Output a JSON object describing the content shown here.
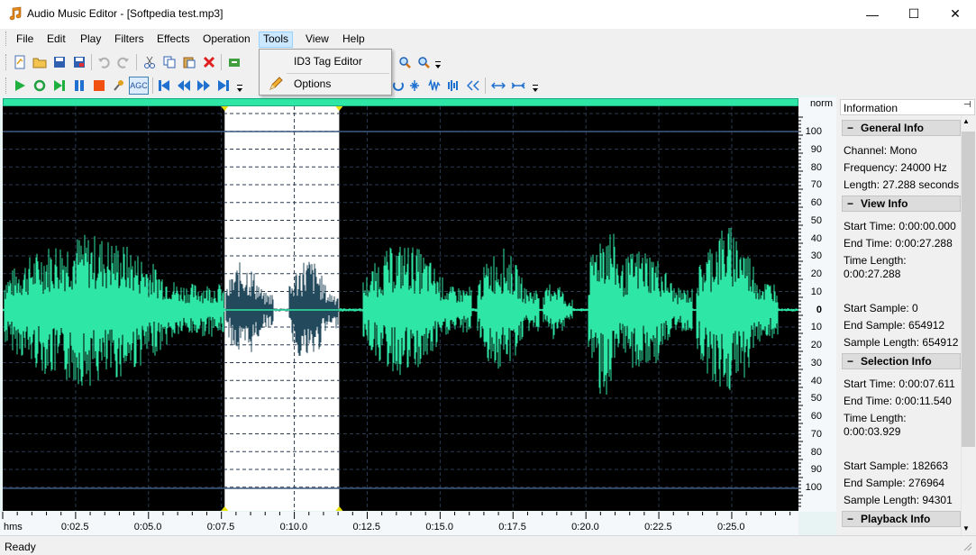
{
  "window": {
    "title": "Audio Music Editor - [Softpedia test.mp3]",
    "minimize": "—",
    "maximize": "☐",
    "close": "✕"
  },
  "menu": [
    {
      "label": "File"
    },
    {
      "label": "Edit"
    },
    {
      "label": "Play"
    },
    {
      "label": "Filters"
    },
    {
      "label": "Effects"
    },
    {
      "label": "Operation"
    },
    {
      "label": "Tools"
    },
    {
      "label": "View"
    },
    {
      "label": "Help"
    }
  ],
  "tools_dropdown": [
    {
      "label": "ID3 Tag Editor"
    },
    {
      "label": "Options"
    }
  ],
  "toolbar_agc": "AGC",
  "ruler": {
    "header": "norm",
    "labels": [
      "100",
      "90",
      "80",
      "70",
      "60",
      "50",
      "40",
      "30",
      "20",
      "10",
      "0",
      "10",
      "20",
      "30",
      "40",
      "50",
      "60",
      "70",
      "80",
      "90",
      "100"
    ]
  },
  "timeline": {
    "unit": "hms",
    "labels": [
      "0:02.5",
      "0:05.0",
      "0:07.5",
      "0:10.0",
      "0:12.5",
      "0:15.0",
      "0:17.5",
      "0:20.0",
      "0:22.5",
      "0:25.0"
    ]
  },
  "status": "Ready",
  "info": {
    "title": "Information",
    "pin": "📌",
    "general": {
      "heading": "General Info",
      "channel": "Channel: Mono",
      "frequency": "Frequency: 24000 Hz",
      "length": "Length: 27.288 seconds"
    },
    "view": {
      "heading": "View Info",
      "start_time": "Start Time: 0:00:00.000",
      "end_time": "End Time: 0:00:27.288",
      "time_length_label": "Time Length:",
      "time_length": "0:00:27.288",
      "start_sample": "Start Sample: 0",
      "end_sample": "End Sample: 654912",
      "sample_length": "Sample Length: 654912"
    },
    "selection": {
      "heading": "Selection Info",
      "start_time": "Start Time: 0:00:07.611",
      "end_time": "End Time: 0:00:11.540",
      "time_length_label": "Time Length:",
      "time_length": "0:00:03.929",
      "start_sample": "Start Sample: 182663",
      "end_sample": "End Sample: 276964",
      "sample_length": "Sample Length: 94301"
    },
    "playback": {
      "heading": "Playback Info"
    }
  },
  "colors": {
    "waveform": "#2ee6a5",
    "selected_waveform": "#23495c",
    "selection_bg": "#ffffff",
    "background": "#000000"
  },
  "selection": {
    "start_seconds": 7.611,
    "end_seconds": 11.54,
    "total_seconds": 27.288
  }
}
